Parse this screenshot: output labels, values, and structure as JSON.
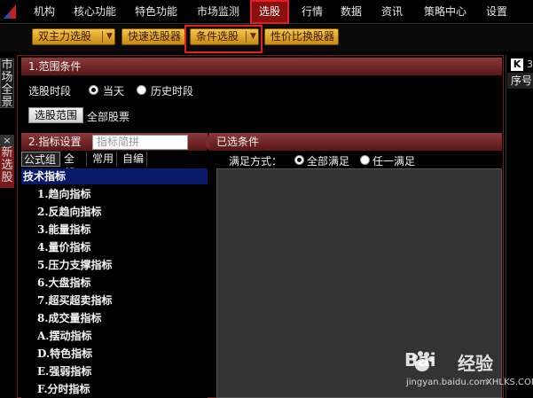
{
  "menu": {
    "items": [
      "机构",
      "核心功能",
      "特色功能",
      "市场监测",
      "选股",
      "行情",
      "数据",
      "资讯",
      "策略中心",
      "设置"
    ],
    "active": "选股"
  },
  "toolbar": {
    "buttons": [
      "双主力选股",
      "快速选股器",
      "条件选股",
      "性价比换股器"
    ]
  },
  "left_tabs": {
    "market_overview": "市场全景",
    "close": "×",
    "new_pick": "新选股"
  },
  "range": {
    "heading": "1.范围条件",
    "period_label": "选股时段",
    "option_today": "当天",
    "option_history": "历史时段",
    "range_button": "选股范围",
    "range_value": "全部股票"
  },
  "indicator": {
    "heading": "2.指标设置",
    "search_placeholder": "指标简拼",
    "tabs": [
      "公式组",
      "全部",
      "常用",
      "自编"
    ],
    "root": "技术指标",
    "items": [
      "1.趋向指标",
      "2.反趋向指标",
      "3.能量指标",
      "4.量价指标",
      "5.压力支撑指标",
      "6.大盘指标",
      "7.超买超卖指标",
      "8.成交量指标",
      "A.摆动指标",
      "D.特色指标",
      "E.强弱指标",
      "F.分时指标"
    ]
  },
  "selected": {
    "heading": "已选条件",
    "satisfy_label": "满足方式：",
    "option_all": "全部满足",
    "option_any": "任一满足"
  },
  "right_panel": {
    "badge": "K",
    "number": "3",
    "column_header": "序号"
  },
  "watermark": {
    "brand": "Bai",
    "brand2": "经验",
    "url": "jingyan.baidu.com",
    "site": "XHLKS.COM"
  }
}
